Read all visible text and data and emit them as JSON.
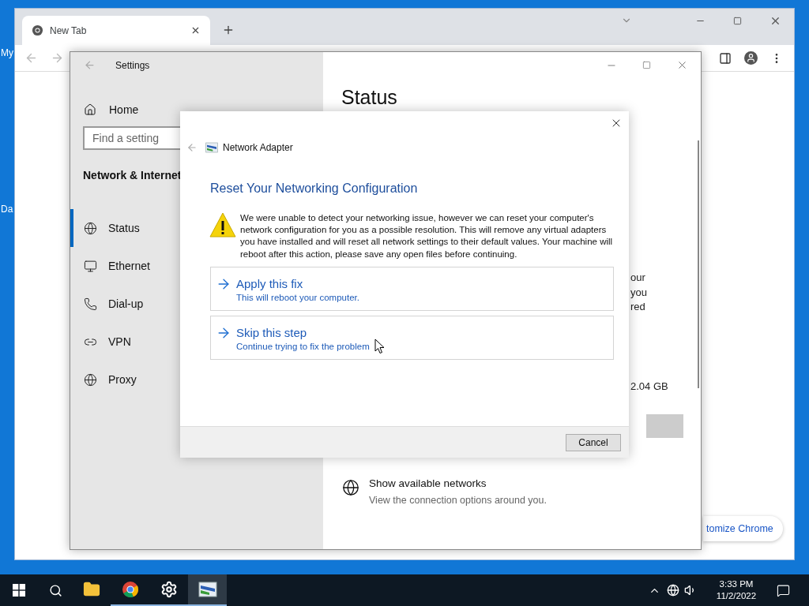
{
  "desktop": {
    "icon_labels": [
      "My",
      "Da"
    ]
  },
  "browser": {
    "tabs": [
      {
        "label": "New Tab",
        "selected": true
      }
    ],
    "customize_button": "tomize Chrome"
  },
  "settings": {
    "title": "Settings",
    "home": "Home",
    "search": {
      "placeholder": "Find a setting"
    },
    "section": "Network & Internet",
    "nav": [
      {
        "label": "Status",
        "kind": "status",
        "selected": true
      },
      {
        "label": "Ethernet",
        "kind": "ethernet",
        "selected": false
      },
      {
        "label": "Dial-up",
        "kind": "dialup",
        "selected": false
      },
      {
        "label": "VPN",
        "kind": "vpn",
        "selected": false
      },
      {
        "label": "Proxy",
        "kind": "proxy",
        "selected": false
      }
    ],
    "page_title": "Status",
    "partial_lines": [
      "our",
      "you",
      "red"
    ],
    "data_usage": "2.04 GB",
    "link": {
      "title": "Show available networks",
      "subtitle": "View the connection options around you."
    }
  },
  "dialog": {
    "app": "Network Adapter",
    "heading": "Reset Your Networking Configuration",
    "message": "We were unable to detect your networking issue, however we can reset your computer's network configuration for you as a possible resolution. This will remove any virtual adapters you have installed and will reset all network settings to their default values. Your machine will reboot after this action, please save any open files before continuing.",
    "options": [
      {
        "title": "Apply this fix",
        "subtitle": "This will reboot your computer."
      },
      {
        "title": "Skip this step",
        "subtitle": "Continue trying to fix the problem"
      }
    ],
    "cancel": "Cancel"
  },
  "taskbar": {
    "apps": [
      {
        "kind": "explorer",
        "running": false,
        "selected": false
      },
      {
        "kind": "chrome",
        "running": true,
        "selected": false
      },
      {
        "kind": "settings",
        "running": true,
        "selected": false
      },
      {
        "kind": "troubleshooter",
        "running": true,
        "selected": true
      }
    ],
    "time": "3:33 PM",
    "date": "11/2/2022"
  }
}
